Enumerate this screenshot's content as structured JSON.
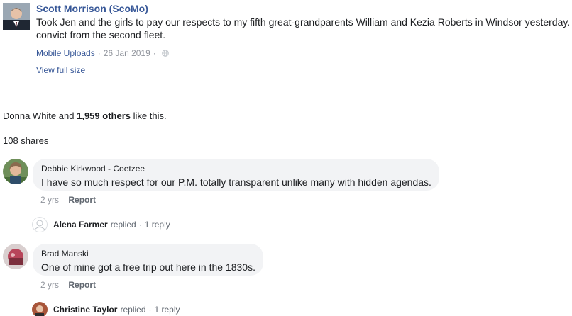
{
  "post": {
    "author": "Scott Morrison (ScoMo)",
    "text_line1": "Took Jen and the girls to pay our respects to my fifth great-grandparents William and Kezia Roberts in Windsor yesterday.",
    "text_line2": "convict from the second fleet.",
    "source": "Mobile Uploads",
    "separator": "·",
    "date": "26 Jan 2019",
    "privacy_icon": "globe-icon",
    "view_full_size": "View full size"
  },
  "reactions": {
    "first_name": "Donna White",
    "and": "and",
    "others": "1,959 others",
    "suffix": "like this."
  },
  "shares": "108 shares",
  "comments": [
    {
      "author": "Debbie Kirkwood - Coetzee",
      "text": "I have so much respect for our P.M. totally transparent unlike many with hidden agendas.",
      "time": "2 yrs",
      "report": "Report",
      "reply": {
        "name": "Alena Farmer",
        "verb": "replied",
        "separator": "·",
        "count": "1 reply"
      }
    },
    {
      "author": "Brad Manski",
      "text": "One of mine got a free trip out here in the 1830s.",
      "time": "2 yrs",
      "report": "Report",
      "reply": {
        "name": "Christine Taylor",
        "verb": "replied",
        "separator": "·",
        "count": "1 reply"
      }
    }
  ],
  "colors": {
    "link_blue": "#385898",
    "meta_gray": "#90949c",
    "bubble_bg": "#f2f3f5",
    "divider": "#dadde1"
  }
}
